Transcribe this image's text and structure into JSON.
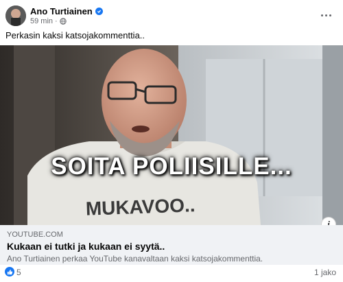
{
  "post": {
    "author": "Ano Turtiainen",
    "time": "59 min",
    "separator": "·",
    "text": "Perkasin kaksi katsojakommenttia.."
  },
  "media": {
    "overlay_text": "SOITA POLIISILLE...",
    "shirt_text": "MUKAVOO..",
    "info_label": "i"
  },
  "link": {
    "domain": "YOUTUBE.COM",
    "title": "Kukaan ei tutki ja kukaan ei syytä..",
    "description": "Ano Turtiainen perkaa YouTube kanavaltaan kaksi katsojakommenttia."
  },
  "footer": {
    "reactions_count": "5",
    "shares": "1 jako"
  },
  "colors": {
    "accent": "#1877f2",
    "secondary_text": "#65676b",
    "link_bg": "#f0f2f5"
  },
  "icons": {
    "verified": "verified-badge-icon",
    "audience": "globe-icon",
    "more": "more-options-icon",
    "like": "like-icon",
    "info": "info-icon"
  }
}
